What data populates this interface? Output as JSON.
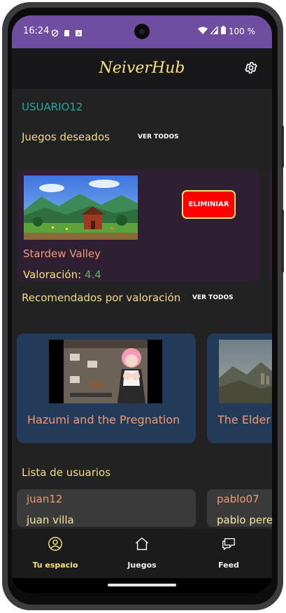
{
  "status": {
    "time": "16:24",
    "battery": "100 %"
  },
  "app": {
    "title": "NeiverHub"
  },
  "profile": {
    "username": "USUARIO12"
  },
  "wishlist": {
    "title": "Juegos deseados",
    "see_all": "VER TODOS",
    "items": [
      {
        "name": "Stardew Valley",
        "rating_label": "Valoración:",
        "rating": "4.4",
        "delete_label": "ELIMINIAR"
      }
    ]
  },
  "recommended": {
    "title": "Recomendados por valoración",
    "see_all": "VER TODOS",
    "items": [
      {
        "name": "Hazumi and the Pregnation"
      },
      {
        "name": "The Elder"
      }
    ]
  },
  "users": {
    "title": "Lista de usuarios",
    "items": [
      {
        "handle": "juan12",
        "full_name": "juan villa"
      },
      {
        "handle": "pablo07",
        "full_name": "pablo perez"
      }
    ]
  },
  "nav": {
    "items": [
      {
        "label": "Tu espacio",
        "icon": "person-circle-icon",
        "active": true
      },
      {
        "label": "Juegos",
        "icon": "home-icon",
        "active": false
      },
      {
        "label": "Feed",
        "icon": "chat-bubbles-icon",
        "active": false
      }
    ]
  },
  "colors": {
    "status_bar": "#6f4ea2",
    "accent_yellow": "#f6e27e",
    "username_teal": "#21a897",
    "delete_red": "#ff0000",
    "game_name_salmon": "#ee9a74",
    "rating_green": "#62b35b",
    "recommended_card": "#233b59",
    "wish_card": "#2f1f33"
  }
}
